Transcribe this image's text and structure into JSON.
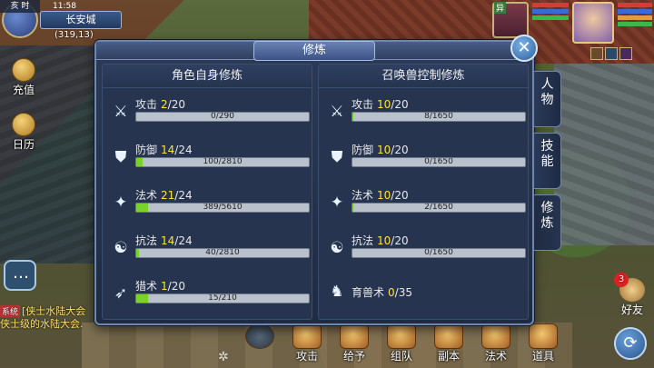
{
  "hud": {
    "time_label": "亥 时",
    "clock": "11:58",
    "city": "长安城",
    "coords": "(319,13)",
    "left_buttons": [
      "充值",
      "日历"
    ],
    "chat_lines": [
      {
        "tag": "系统",
        "text": "[侠士水陆大会"
      },
      {
        "tag": "",
        "text": "侠士级的水陆大会."
      }
    ],
    "pet_tag": "异",
    "friend_label": "好友",
    "friend_badge": "3"
  },
  "bottom_menu": [
    {
      "label": "攻击",
      "icon": "attack-icon"
    },
    {
      "label": "给予",
      "icon": "give-icon"
    },
    {
      "label": "组队",
      "icon": "team-icon"
    },
    {
      "label": "副本",
      "icon": "dungeon-icon"
    },
    {
      "label": "法术",
      "icon": "spell-icon"
    },
    {
      "label": "道具",
      "icon": "item-icon"
    }
  ],
  "dialog": {
    "title": "修炼",
    "close_label": "✕",
    "side_tabs": [
      {
        "label": "人\n物",
        "active": false
      },
      {
        "label": "技\n能",
        "active": false
      },
      {
        "label": "修\n炼",
        "active": true
      }
    ],
    "left_panel": {
      "header": "角色自身修炼",
      "rows": [
        {
          "icon": "sword-icon",
          "name": "攻击",
          "level": "2",
          "max": "/20",
          "progress": "0/290",
          "fill": 0.0
        },
        {
          "icon": "shield-icon",
          "name": "防御",
          "level": "14",
          "max": "/24",
          "progress": "100/2810",
          "fill": 0.036
        },
        {
          "icon": "magic-wand-icon",
          "name": "法术",
          "level": "21",
          "max": "/24",
          "progress": "389/5610",
          "fill": 0.07
        },
        {
          "icon": "yin-yang-icon",
          "name": "抗法",
          "level": "14",
          "max": "/24",
          "progress": "40/2810",
          "fill": 0.014
        },
        {
          "icon": "bow-icon",
          "name": "猎术",
          "level": "1",
          "max": "/20",
          "progress": "15/210",
          "fill": 0.07
        }
      ]
    },
    "right_panel": {
      "header": "召唤兽控制修炼",
      "rows": [
        {
          "icon": "sword-icon",
          "name": "攻击",
          "level": "10",
          "max": "/20",
          "progress": "8/1650",
          "fill": 0.005
        },
        {
          "icon": "shield-icon",
          "name": "防御",
          "level": "10",
          "max": "/20",
          "progress": "0/1650",
          "fill": 0.0
        },
        {
          "icon": "magic-wand-icon",
          "name": "法术",
          "level": "10",
          "max": "/20",
          "progress": "2/1650",
          "fill": 0.001
        },
        {
          "icon": "yin-yang-icon",
          "name": "抗法",
          "level": "10",
          "max": "/20",
          "progress": "0/1650",
          "fill": 0.0
        },
        {
          "icon": "beast-icon",
          "name": "育兽术",
          "level": "0",
          "max": "/35",
          "progress": "",
          "fill": null
        }
      ]
    }
  },
  "colors": {
    "bar_fill": "#7ad12a",
    "level_highlight": "#ffe23a",
    "panel_bg": "#263450"
  }
}
